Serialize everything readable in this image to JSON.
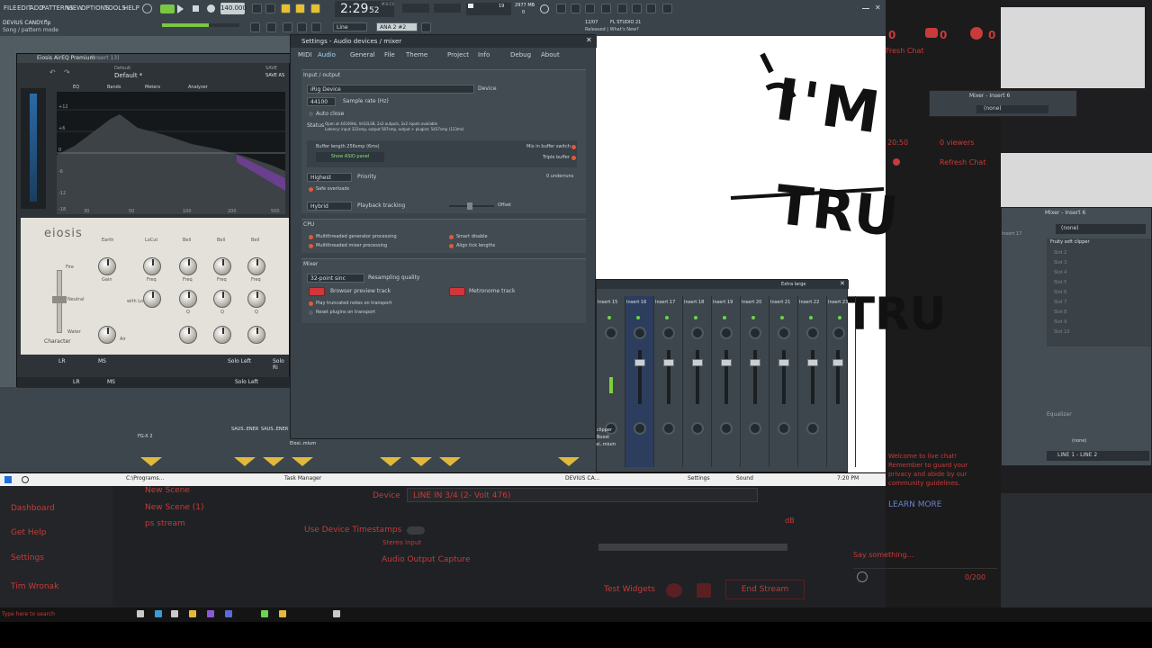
{
  "fl": {
    "menus": [
      "FILE",
      "EDIT",
      "ADD",
      "PATTERNS",
      "VIEW",
      "OPTIONS",
      "TOOLS",
      "HELP"
    ],
    "tempo": "140.000",
    "time": "2:29",
    "time_sub": "52",
    "time_unit": "M:S:CS",
    "pattern_mode": "Line",
    "ana_label": "ANA 2 #2",
    "cpu": "19",
    "mem": "2977 MB",
    "mem_sub": "0",
    "song_title": "DEVIUS CANDY.flp",
    "song_sub": "Song / pattern mode",
    "news_date": "12/07",
    "news_title": "FL STUDIO 21",
    "news_sub": "Released | What's New?"
  },
  "eq": {
    "title": "Eiosis AirEQ Premium",
    "title_sub": "(Insert 13)",
    "preset_category": "Default",
    "preset_name": "Default *",
    "save": "SAVE",
    "save_as": "SAVE AS",
    "tabs": [
      "EQ",
      "Bands",
      "Meters",
      "Analyzer"
    ],
    "db_labels": [
      "+12",
      "+6",
      "0",
      "-6",
      "-12",
      "-18"
    ],
    "left_scale": [
      "0",
      "-6",
      "-12",
      "-24",
      "-36",
      "-48"
    ],
    "freq_labels": [
      "30",
      "50",
      "100",
      "200",
      "500"
    ],
    "brand": "eiosis",
    "band_names": [
      "Earth",
      "LoCut",
      "Bell",
      "Bell",
      "Bell",
      "Bell"
    ],
    "knob_labels": [
      "Gain",
      "Freq",
      "Freq",
      "Freq",
      "Freq",
      "Freq"
    ],
    "knob_labels_row2": [
      "",
      "Freq",
      "Q",
      "Q",
      "Q",
      "Q"
    ],
    "fire": "Fire",
    "neutral": "Neutral",
    "water": "Water",
    "character": "Character",
    "width_load": "with Load",
    "air": "Air",
    "bottom": [
      "LR",
      "MS",
      "Solo Left",
      "Solo Ri"
    ],
    "bottom2": [
      "LR",
      "MS",
      "Solo Left"
    ]
  },
  "settings": {
    "title": "Settings - Audio devices / mixer",
    "tabs": [
      "MIDI",
      "Audio",
      "General",
      "File",
      "Theme",
      "Project",
      "Info",
      "Debug",
      "About"
    ],
    "active_tab": "Audio",
    "input_output": "Input / output",
    "device_value": "iRig Device",
    "device_label": "Device",
    "sample_rate_value": "44100",
    "sample_rate_label": "Sample rate (Hz)",
    "auto_close": "Auto close",
    "status_label": "Status",
    "status_line1": "Open at 44100Hz, Int32LSB, 2x2 outputs, 2x2 inputs available",
    "status_line2": "Latency: input 322smp, output 587smp, output + plugins: 5437smp (123ms)",
    "buffer_length": "Buffer length 256smp (6ms)",
    "show_asio": "Show ASIO panel",
    "mix_in_buffer": "Mix in buffer switch",
    "triple_buffer": "Triple buffer",
    "priority_value": "Highest",
    "priority_label": "Priority",
    "underruns": "0 underruns",
    "safe_overloads": "Safe overloads",
    "playback_value": "Hybrid",
    "playback_label": "Playback tracking",
    "offset": "Offset",
    "cpu_heading": "CPU",
    "multi_gen": "Multithreaded generator processing",
    "multi_mixer": "Multithreaded mixer processing",
    "smart_disable": "Smart disable",
    "align_tick": "Align tick lengths",
    "mixer_heading": "Mixer",
    "resampling_value": "32-point sinc",
    "resampling_label": "Resampling quality",
    "browser_preview": "Browser preview track",
    "metronome": "Metronome track",
    "play_truncated": "Play truncated notes on transport",
    "reset_plugins": "Reset plugins on transport"
  },
  "mixer": {
    "size": "Extra large",
    "channels": [
      "Insert 15",
      "Insert 16",
      "Insert 17",
      "Insert 18",
      "Insert 19",
      "Insert 20",
      "Insert 21",
      "Insert 22",
      "Insert 23"
    ],
    "numbers": [
      "15",
      "16",
      "17",
      "18",
      "19",
      "20",
      "21",
      "22",
      "23"
    ],
    "bottom_labels": [
      "FG-X 2",
      "SAUS..ENER",
      "SAUS..ENER",
      "Eiosi..mium",
      "clipper",
      "Boost",
      "Eiosi..mium"
    ]
  },
  "taskbar": {
    "items": [
      "C:\\Programs...",
      "Task Manager",
      "DEVIUS CA...",
      "Settings",
      "Sound"
    ],
    "clock": "7:20 PM",
    "search": "Type here to search"
  },
  "stream": {
    "sidebar": [
      "Dashboard",
      "Get Help",
      "Settings",
      "Tim Wronak"
    ],
    "scenes": [
      "New Scene",
      "New Scene (1)",
      "ps stream"
    ],
    "device_label": "Device",
    "device_value": "LINE IN 3/4 (2- Volt 476)",
    "use_timestamps": "Use Device Timestamps",
    "stereo_input": "Stereo Input",
    "audio_output": "Audio Output Capture",
    "test_widgets": "Test Widgets",
    "end_stream": "End Stream",
    "db": "dB"
  },
  "chat": {
    "counts": [
      "0",
      "0",
      "0"
    ],
    "fresh": "Fresh Chat",
    "viewers": "0 viewers",
    "refresh": "Refresh Chat",
    "time": "20:50",
    "welcome": "Welcome to live chat! Remember to guard your privacy and abide by our community guidelines.",
    "learn_more": "LEARN MORE",
    "say_something": "Say something...",
    "char_count": "0/200"
  },
  "right_mixers": {
    "mixer1_title": "Mixer - Insert 6",
    "mixer1_none": "(none)",
    "mixer2_title": "Mixer - Insert 6",
    "mixer2_none": "(none)",
    "fruity": "Fruity soft clipper",
    "slots": [
      "Slot 2",
      "Slot 3",
      "Slot 4",
      "Slot 5",
      "Slot 6",
      "Slot 7",
      "Slot 8",
      "Slot 9",
      "Slot 10"
    ],
    "equalizer": "Equalizer",
    "none2": "(none)",
    "line": "LINE 1 - LINE 2",
    "insert17": "Insert 17",
    "insert18": "Insert"
  },
  "playlist_text": [
    "I'M",
    "TRU",
    "TRU"
  ]
}
